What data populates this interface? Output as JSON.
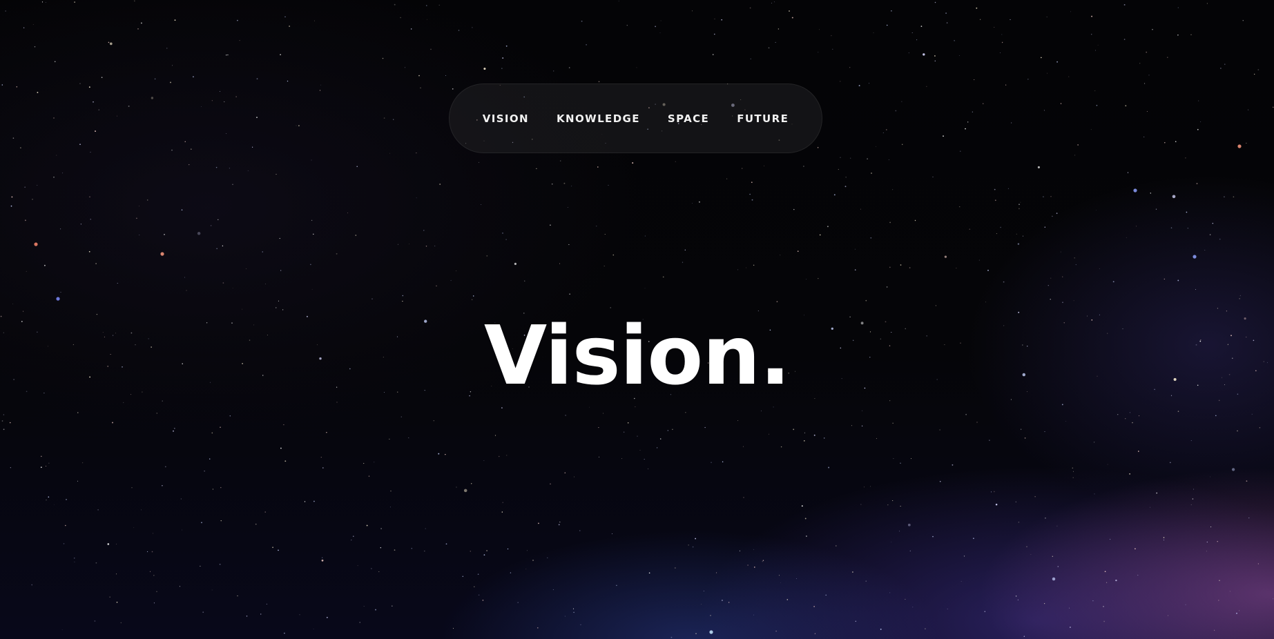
{
  "nav": {
    "items": [
      {
        "label": "VISION"
      },
      {
        "label": "KNOWLEDGE"
      },
      {
        "label": "SPACE"
      },
      {
        "label": "FUTURE"
      }
    ]
  },
  "hero": {
    "title": "Vision."
  },
  "background": {
    "description_colors": {
      "base": "#040406",
      "nebula_purple": "#9650a0",
      "nebula_blue": "#3c46a0"
    }
  }
}
